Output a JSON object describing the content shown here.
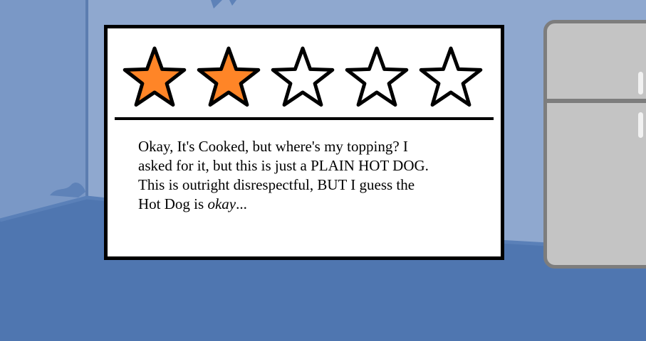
{
  "rating": {
    "value": 2,
    "max": 5,
    "filled_color": "#ff8527",
    "empty_color": "#ffffff",
    "outline_color": "#000000"
  },
  "review": {
    "line1": "Okay, It's Cooked, but where's my topping? I",
    "line2": "asked for it, but this is just a PLAIN HOT DOG.",
    "line3": "This is outright disrespectful, BUT I guess the",
    "line4_prefix": "Hot Dog is ",
    "line4_emphasis": "okay",
    "line4_suffix": "..."
  },
  "scene": {
    "wall_color": "#8fa8cf",
    "floor_color": "#4f76b0",
    "fridge": "fridge"
  }
}
